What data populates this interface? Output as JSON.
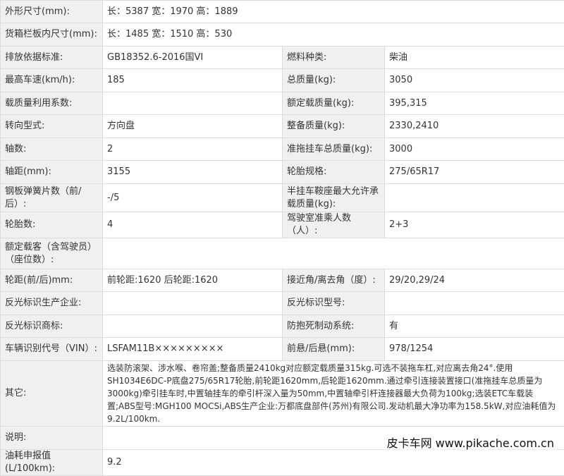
{
  "rows": [
    {
      "l1": "外形尺寸(mm):",
      "v1": "长：5387 宽：1970 高：1889"
    },
    {
      "l1": "货箱栏板内尺寸(mm):",
      "v1": "长：1485 宽：1510 高：530"
    },
    {
      "l1": "排放依据标准:",
      "v1": "GB18352.6-2016国VI",
      "l2": "燃料种类:",
      "v2": "柴油"
    },
    {
      "l1": "最高车速(km/h):",
      "v1": "185",
      "l2": "总质量(kg):",
      "v2": "3050"
    },
    {
      "l1": "载质量利用系数:",
      "v1": "",
      "l2": "额定载质量(kg):",
      "v2": "395,315"
    },
    {
      "l1": "转向型式:",
      "v1": "方向盘",
      "l2": "整备质量(kg):",
      "v2": "2330,2410"
    },
    {
      "l1": "轴数:",
      "v1": "2",
      "l2": "准拖挂车总质量(kg):",
      "v2": "3000"
    },
    {
      "l1": "轴距(mm):",
      "v1": "3155",
      "l2": "轮胎规格:",
      "v2": "275/65R17"
    },
    {
      "l1": "钢板弹簧片数（前/后）:",
      "v1": "-/5",
      "l2": "半挂车鞍座最大允许承载质量(kg):",
      "v2": ""
    },
    {
      "l1": "轮胎数:",
      "v1": "4",
      "l2": "驾驶室准乘人数（人）:",
      "v2": "2+3"
    },
    {
      "l1": "额定载客（含驾驶员）（座位数）:",
      "v1": ""
    },
    {
      "l1": "轮距(前/后)mm:",
      "v1": "前轮距:1620 后轮距:1620",
      "l2": "接近角/离去角（度）:",
      "v2": "29/20,29/24"
    },
    {
      "l1": "反光标识生产企业:",
      "v1": "",
      "l2": "反光标识型号:",
      "v2": ""
    },
    {
      "l1": "反光标识商标:",
      "v1": "",
      "l2": "防抱死制动系统:",
      "v2": "有"
    },
    {
      "l1": "车辆识别代号（VIN）:",
      "v1": "LSFAM11B×××××××××",
      "l2": "前悬/后悬(mm):",
      "v2": "978/1254"
    },
    {
      "l1": "其它:",
      "v1": "选装防滚架、涉水喉、卷帘盖;整备质量2410kg对应额定载质量315kg.可选不装拖车杠,对应离去角24°.使用SH1034E6DC-P底盘275/65R17轮胎,前轮距1620mm,后轮距1620mm.通过牵引连接装置接口(准拖挂车总质量为3000kg)牵引挂车时,中置轴挂车的牵引杆深入量为50mm,中置轴牵引杆连接器最大负荷为100kg;选装ETC车载装置;ABS型号:MGH100 MOCSi,ABS生产企业:万都底盘部件(苏州)有限公司.发动机最大净功率为158.5kW,对应油耗值为9.2L/100km."
    },
    {
      "l1": "说明:",
      "v1": ""
    },
    {
      "l1": "油耗申报值(L/100km):",
      "v1": "9.2"
    }
  ],
  "watermark": "皮卡车网  www.pikache.com.cn"
}
